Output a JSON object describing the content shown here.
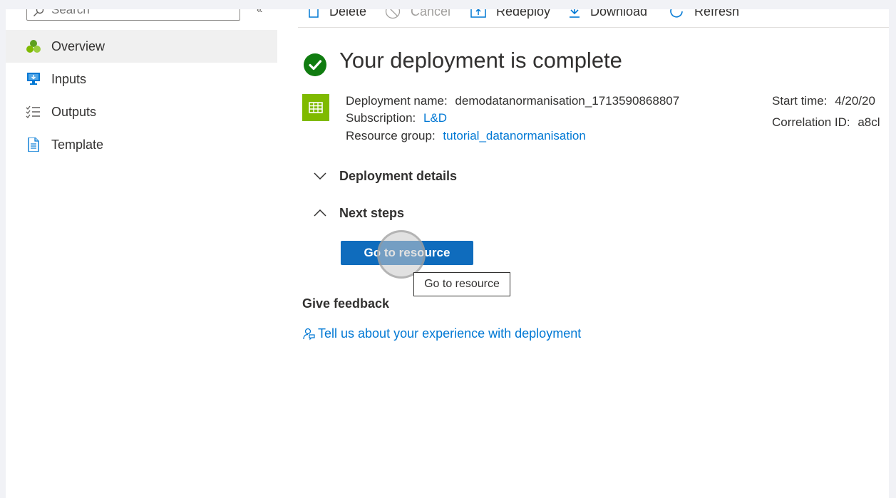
{
  "sidebar": {
    "search_placeholder": "Search",
    "collapse_glyph": "«",
    "items": [
      {
        "label": "Overview",
        "icon": "overview-icon"
      },
      {
        "label": "Inputs",
        "icon": "inputs-icon"
      },
      {
        "label": "Outputs",
        "icon": "outputs-icon"
      },
      {
        "label": "Template",
        "icon": "template-icon"
      }
    ]
  },
  "toolbar": {
    "delete": "Delete",
    "cancel": "Cancel",
    "redeploy": "Redeploy",
    "download": "Download",
    "refresh": "Refresh"
  },
  "main": {
    "title": "Your deployment is complete",
    "deployment_name_label": "Deployment name:",
    "deployment_name": "demodatanormanisation_1713590868807",
    "subscription_label": "Subscription:",
    "subscription": "L&D",
    "resource_group_label": "Resource group:",
    "resource_group": "tutorial_datanormanisation",
    "start_time_label": "Start time:",
    "start_time": "4/20/20",
    "correlation_label": "Correlation ID:",
    "correlation_id": "a8cl",
    "deployment_details": "Deployment details",
    "next_steps": "Next steps",
    "go_to_resource": "Go to resource",
    "tooltip": "Go to resource",
    "feedback_title": "Give feedback",
    "feedback_link": "Tell us about your experience with deployment"
  },
  "colors": {
    "accent": "#0f6cbd",
    "link": "#0078d4",
    "success": "#107c10",
    "resource": "#7fba00"
  }
}
